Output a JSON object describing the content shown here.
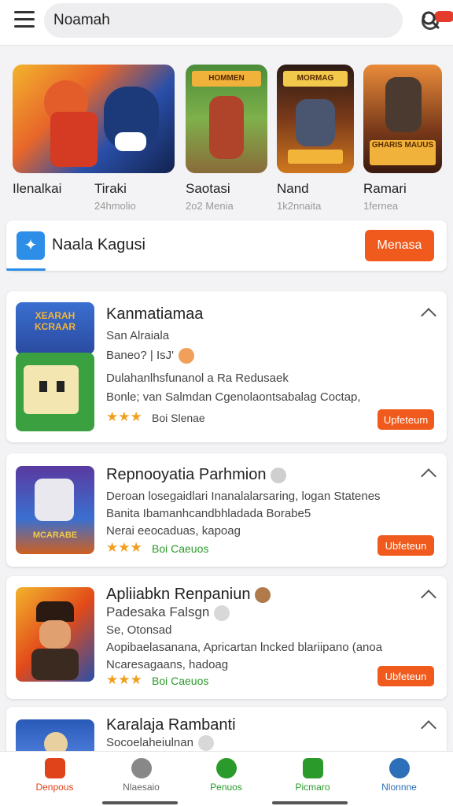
{
  "topbar": {
    "search_value": "Noamah",
    "badge": ""
  },
  "featured": [
    {
      "title": "Ilenalkai",
      "sub": "",
      "art": ""
    },
    {
      "title": "Tiraki",
      "sub": "24hmolio",
      "art": ""
    },
    {
      "title": "Saotasi",
      "sub": "2o2 Menia",
      "art": "HOMMEN"
    },
    {
      "title": "Nand",
      "sub": "1k2nnaita",
      "art": "MORMAG"
    },
    {
      "title": "Ramari",
      "sub": "1fernea",
      "art": "GHARIS MAUUS"
    }
  ],
  "promo": {
    "title": "Naala Kagusi",
    "button": "Menasa"
  },
  "cards": [
    {
      "title": "Kanmatiamaa",
      "lines": [
        "San Alraiala",
        "Baneo? | IsJ'"
      ],
      "desc": [
        "Dulahanlhsfunanol a Ra Redusaek",
        "Bonle; van Salmdan Cgenolaontsabalag Coctap,"
      ],
      "stars": "★★★",
      "rating_label": "Boi Slenae",
      "button": "Upfeteum",
      "art": "XEARAH KCRAAR"
    },
    {
      "title": "Repnooyatia Parhmion",
      "lines": [],
      "desc": [
        "Deroan losegaidlari Inanalalarsaring, logan Statenes",
        "Banita  Ibamanhcandbhladada Borabe5",
        "Nerai eeocaduas, kapoag"
      ],
      "stars": "★★★",
      "rating_label": "Boi Caeuos",
      "button": "Ubfeteun",
      "art": "MCARABE"
    },
    {
      "title": "Apliiabkn Renpaniun",
      "lines": [
        "Padesaka Falsgn",
        "Se, Otonsad"
      ],
      "desc": [
        "Aopibaelasanana, Apricartan lncked blariipano (anoa",
        "Ncaresagaans, hadoag"
      ],
      "stars": "★★★",
      "rating_label": "Boi Caeuos",
      "button": "Ubfeteun",
      "art": ""
    },
    {
      "title": "Karalaja Rambanti",
      "lines": [
        "Socoelaheiulnan"
      ],
      "desc": [],
      "stars": "",
      "rating_label": "",
      "button": "",
      "art": ""
    }
  ],
  "bottomnav": [
    {
      "label": "Denpous",
      "color": "#e0421a"
    },
    {
      "label": "Nlaesaio",
      "color": "#666666"
    },
    {
      "label": "Penuos",
      "color": "#2a9a2a"
    },
    {
      "label": "Picmaro",
      "color": "#2a9a2a"
    },
    {
      "label": "Nlonnne",
      "color": "#2d6fb8"
    }
  ]
}
